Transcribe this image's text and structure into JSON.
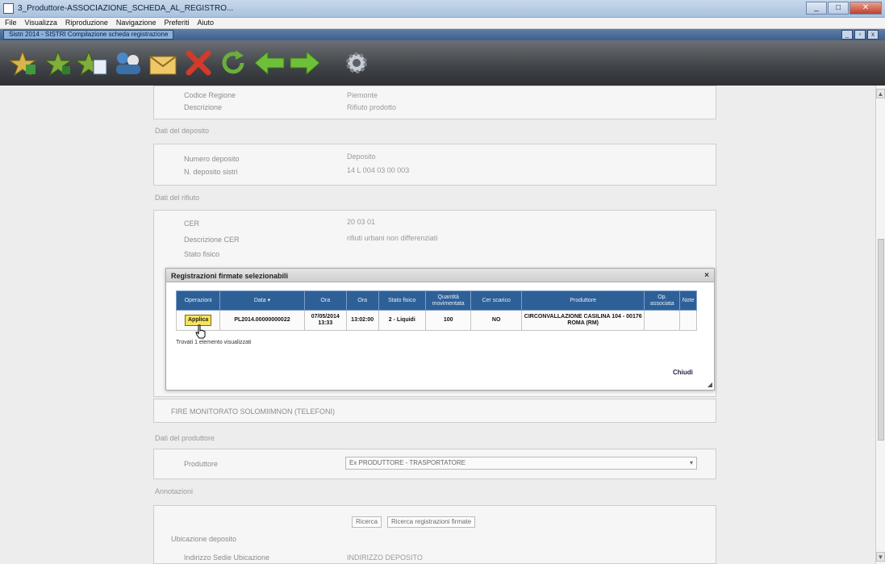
{
  "window": {
    "title": "3_Produttore-ASSOCIAZIONE_SCHEDA_AL_REGISTRO..."
  },
  "menu": {
    "items": [
      "File",
      "Visualizza",
      "Riproduzione",
      "Navigazione",
      "Preferiti",
      "Aiuto"
    ]
  },
  "browser_tab": {
    "label": "Sistri 2014 - SISTRI Compilazione scheda registrazione"
  },
  "toolbar": {
    "icons": [
      "star-add-icon",
      "star-add-icon",
      "star-edit-icon",
      "people-icon",
      "envelope-icon",
      "cross-icon",
      "refresh-icon",
      "arrow-left-icon",
      "arrow-right-icon",
      "gear-icon"
    ]
  },
  "form_top": {
    "row1_label": "Codice Regione",
    "row1_value": "Piemonte",
    "row2_label": "Descrizione",
    "row2_value": "Rifiuto prodotto"
  },
  "section_dati_deposito": {
    "label": "Dati del deposito",
    "row1_label": "Numero deposito",
    "row1_value": "Deposito",
    "row2_label": "N. deposito sistri",
    "row2_value": "14 L 004 03 00 003"
  },
  "section_rifiuto": {
    "label": "Dati del rifiuto",
    "row1_label": "CER",
    "row1_value": "20 03 01",
    "row2_label": "Descrizione CER",
    "row2_value": "rifiuti urbani non differenziati",
    "row3_label": "Stato fisico"
  },
  "dialog": {
    "title": "Registrazioni firmate selezionabili",
    "close_label": "×",
    "headers": [
      "Operazioni",
      "Data ▾",
      "Ora",
      "Ora",
      "Stato fisico",
      "Quantità movimentata",
      "Cer scarico",
      "Produttore",
      "Op. associata",
      "Note"
    ],
    "rows": [
      {
        "action_label": "Applica",
        "code": "PL2014.00000000022",
        "date": "07/05/2014",
        "time": "13:33",
        "hour": "13:02:00",
        "state": "2 - Liquidi",
        "quantity": "100",
        "cer": "NO",
        "producer": "CIRCONVALLAZIONE CASILINA 104 - 00176 ROMA (RM)",
        "op": "",
        "note": ""
      }
    ],
    "footer_text": "Trovati 1 elemento visualizzati",
    "chiudi_label": "Chiudi"
  },
  "section_bottom": {
    "field1": "FIRE MONITORATO SOLOMIIMNON (TELEFONI)",
    "section2_label": "Dati del produttore",
    "field2_label": "Produttore",
    "field2_value": "Ex PRODUTTORE - TRASPORTATORE",
    "section3_label": "Annotazioni",
    "pill1": "Ricerca",
    "pill2": "Ricerca registrazioni firmate",
    "section4_label": "Ubicazione deposito",
    "field4_label": "Indirizzo Sedie Ubicazione",
    "field4_value": "INDIRIZZO DEPOSITO"
  }
}
